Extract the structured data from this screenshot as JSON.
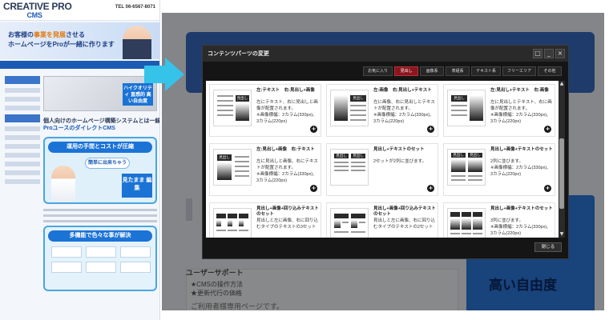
{
  "thumbnail": {
    "logo_line1": "CREATIVE PRO",
    "logo_line2": "CMS",
    "tel": "TEL 06-6567-8071",
    "hero_line1_pre": "お客様の",
    "hero_line1_em": "事業を発展",
    "hero_line1_post": "させる",
    "hero_line2": "ホームページをProが一緒に作ります",
    "shot_badge": "ハイクオリティ 直感的 高い自由度",
    "sub_heading_1": "個人向けのホームページ構築システムとは一線を画す",
    "sub_heading_2": "ProユースのダイレクトCMS",
    "box1_title": "運用の手間とコストが圧縮",
    "box1_bubble": "簡単に出来ちゃう",
    "box1_badge": "見たまま 編集",
    "box2_title": "多機能で色々な事が解決"
  },
  "background_page": {
    "support_heading": "ユーザーサポート",
    "support_item1": "★CMSの操作方法",
    "support_item2": "★更新代行の価格",
    "footer_text": "ご利用者様専用ページです。",
    "badge_text": "高い自由度"
  },
  "modal": {
    "title": "コンテンツパーツの変更",
    "tabs": [
      {
        "label": "お気に入り",
        "active": false
      },
      {
        "label": "見出し",
        "active": true
      },
      {
        "label": "画像系",
        "active": false
      },
      {
        "label": "表組系",
        "active": false
      },
      {
        "label": "テキスト系",
        "active": false
      },
      {
        "label": "フリーエリア",
        "active": false
      },
      {
        "label": "その他",
        "active": false
      }
    ],
    "close_label": "閉じる",
    "cards": [
      {
        "title": "左:テキスト　右:見出し+画像",
        "desc": "左にテキスト、右に見出しと画像が配置されます。\n※画像横幅：2カラム(330px)、3カラム(220px)"
      },
      {
        "title": "左:画像　右:見出し+テキスト",
        "desc": "左に画像、右に見出しとテキストが配置されます。\n※画像横幅：2カラム(330px)、3カラム(220px)"
      },
      {
        "title": "左:見出し+テキスト　右:画像",
        "desc": "左に見出しとテキスト、右に画像が配置されます。\n※画像横幅：2カラム(330px)、3カラム(220px)"
      },
      {
        "title": "左:見出し+画像　右:テキスト",
        "desc": "左に見出しと画像、右にテキストが配置されます。\n※画像横幅：2カラム(330px)、3カラム(220px)"
      },
      {
        "title": "見出し+テキストのセット",
        "desc": "2セットが2列に並びます。"
      },
      {
        "title": "見出し+画像+テキストのセット",
        "desc": "2列に並びます。\n※画像横幅：2カラム(330px)、3カラム(220px)"
      },
      {
        "title": "見出し+画像+回り込みテキストのセット",
        "desc": "見出しと左に画像、右に回り込むタイプのテキストの3セット"
      },
      {
        "title": "見出し+画像+回り込みテキストのセット",
        "desc": "見出しと左に画像、右に回り込むタイプのテキストの2セット"
      },
      {
        "title": "見出し+画像+テキストのセット",
        "desc": "3列に並びます。\n※画像横幅：2カラム(330px)、3カラム(220px)"
      }
    ]
  },
  "colors": {
    "accent_blue": "#1b73d6",
    "modal_bg": "#151515",
    "active_tab": "#8a1620",
    "arrow_cyan": "#35c3ea"
  }
}
